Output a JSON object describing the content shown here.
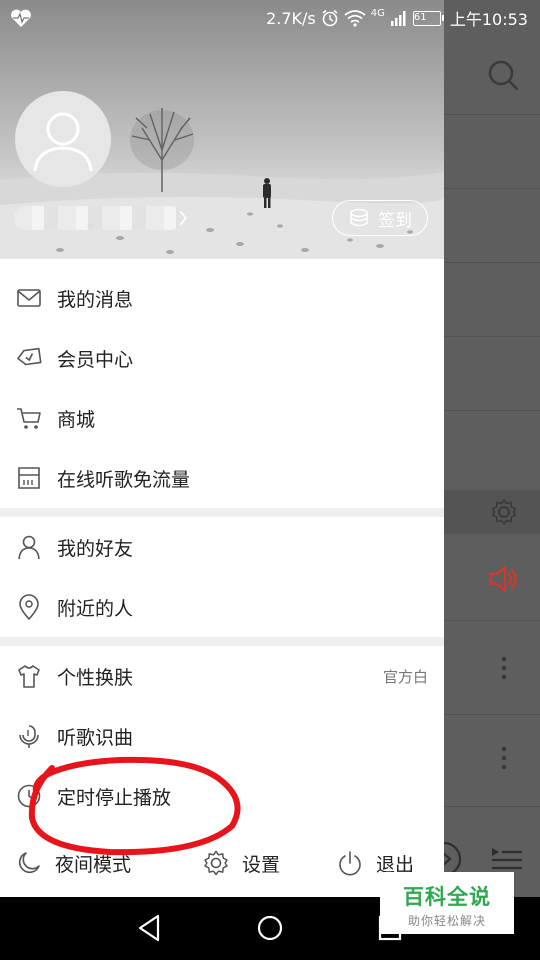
{
  "status_bar": {
    "net_speed": "2.7K/s",
    "network_type": "4G",
    "battery": "61",
    "time": "上午10:53",
    "icons": [
      "heartbeat-icon",
      "alarm-icon",
      "wifi-icon",
      "signal-icon",
      "battery-icon"
    ]
  },
  "header": {
    "checkin_label": "签到"
  },
  "menu": {
    "section1": [
      {
        "label": "我的消息",
        "icon": "mail-icon"
      },
      {
        "label": "会员中心",
        "icon": "diamond-icon"
      },
      {
        "label": "商城",
        "icon": "cart-icon"
      },
      {
        "label": "在线听歌免流量",
        "icon": "sim-card-icon"
      }
    ],
    "section2": [
      {
        "label": "我的好友",
        "icon": "person-icon"
      },
      {
        "label": "附近的人",
        "icon": "location-icon"
      }
    ],
    "section3": [
      {
        "label": "个性换肤",
        "icon": "shirt-icon",
        "value": "官方白"
      },
      {
        "label": "听歌识曲",
        "icon": "microphone-icon"
      },
      {
        "label": "定时停止播放",
        "icon": "clock-icon"
      }
    ]
  },
  "bottom_bar": {
    "night_mode": "夜间模式",
    "settings": "设置",
    "logout": "退出"
  },
  "watermark": {
    "title": "百科全说",
    "subtitle": "助你轻松解决"
  },
  "colors": {
    "annotation": "#e8141b",
    "speaker_red": "#d9352b",
    "watermark_green": "#2fa84f"
  }
}
